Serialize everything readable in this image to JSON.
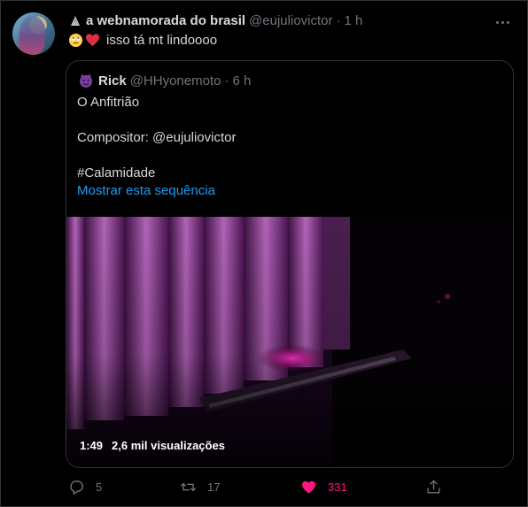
{
  "tweet": {
    "author_name": "a webnamorada do brasil",
    "author_handle": "@eujuliovictor",
    "separator": "·",
    "time": "1 h",
    "text": "isso tá mt lindoooo",
    "name_emoji_icon": "shell-icon",
    "text_emojis": [
      "rolling-eyes-face-icon",
      "red-heart-icon"
    ]
  },
  "quote": {
    "author_name": "Rick",
    "author_handle": "@HHyonemoto",
    "separator": "·",
    "time": "6 h",
    "avatar_icon": "purple-devil-icon",
    "lines": [
      "O Anfitrião",
      "Compositor: @eujuliovictor",
      "#Calamidade"
    ],
    "thread_link": "Mostrar esta sequência",
    "video": {
      "duration": "1:49",
      "views": "2,6 mil visualizações"
    }
  },
  "actions": {
    "reply_count": "5",
    "retweet_count": "17",
    "like_count": "331",
    "like_active": true
  },
  "colors": {
    "background": "#000000",
    "text": "#d9d9d9",
    "muted": "#6e767d",
    "link": "#1d9bf0",
    "like": "#f91880",
    "border": "#2f3336"
  }
}
